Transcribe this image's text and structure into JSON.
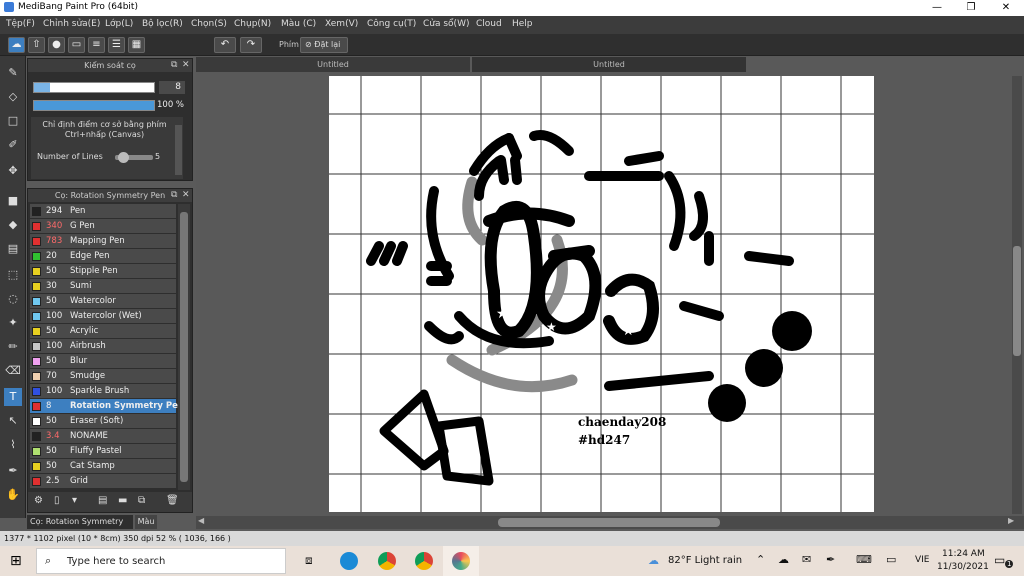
{
  "window": {
    "title": "MediBang Paint Pro (64bit)",
    "min": "—",
    "max": "❐",
    "close": "✕"
  },
  "menu": [
    "Tệp(F)",
    "Chỉnh sửa(E)",
    "Lớp(L)",
    "Bộ lọc(R)",
    "Chọn(S)",
    "Chụp(N)",
    "Màu (C)",
    "Xem(V)",
    "Công cụ(T)",
    "Cửa sổ(W)",
    "Cloud",
    "Help"
  ],
  "toolbar": {
    "keys_label": "Phím",
    "reset_label": "Đặt lại",
    "undo_icon": "undo-icon",
    "redo_icon": "redo-icon"
  },
  "brush_control": {
    "title": "Kiểm soát cọ",
    "size_value": "8",
    "opacity_value": "100 %",
    "hint": "Chỉ định điểm cơ sở bằng phím Ctrl+nhấp (Canvas)",
    "lines_label": "Number of Lines",
    "lines_value": "5",
    "size_fraction": 0.13,
    "opacity_fraction": 1.0,
    "lines_fraction": 0.1
  },
  "brush_panel": {
    "title": "Cọ: Rotation Symmetry Pen",
    "brushes": [
      {
        "size": "294",
        "name": "Pen",
        "color": "#222222"
      },
      {
        "size": "340",
        "name": "G Pen",
        "color": "#e03030",
        "red": true
      },
      {
        "size": "783",
        "name": "Mapping Pen",
        "color": "#e03030",
        "red": true
      },
      {
        "size": "20",
        "name": "Edge Pen",
        "color": "#30c030"
      },
      {
        "size": "50",
        "name": "Stipple Pen",
        "color": "#e8d020"
      },
      {
        "size": "30",
        "name": "Sumi",
        "color": "#e8d020"
      },
      {
        "size": "50",
        "name": "Watercolor",
        "color": "#70c8f0"
      },
      {
        "size": "100",
        "name": "Watercolor (Wet)",
        "color": "#70c8f0"
      },
      {
        "size": "50",
        "name": "Acrylic",
        "color": "#e8d020"
      },
      {
        "size": "100",
        "name": "Airbrush",
        "color": "#c8c8c8"
      },
      {
        "size": "50",
        "name": "Blur",
        "color": "#f0a0f0"
      },
      {
        "size": "70",
        "name": "Smudge",
        "color": "#f0d0b0"
      },
      {
        "size": "100",
        "name": "Sparkle Brush",
        "color": "#3050e0"
      },
      {
        "size": "8",
        "name": "Rotation Symmetry Pen",
        "color": "#e03030",
        "selected": true
      },
      {
        "size": "50",
        "name": "Eraser (Soft)",
        "color": "#ffffff"
      },
      {
        "size": "3.4",
        "name": "NONAME",
        "color": "#222222",
        "red": true
      },
      {
        "size": "50",
        "name": "Fluffy Pastel",
        "color": "#b0e070"
      },
      {
        "size": "50",
        "name": "Cat Stamp",
        "color": "#e8d020"
      },
      {
        "size": "2.5",
        "name": "Grid",
        "color": "#e03030"
      }
    ],
    "footer_tab_active": "Cọ: Rotation Symmetry Pen",
    "footer_tab_other": "Màu"
  },
  "tabs": [
    "Untitled",
    "Untitled"
  ],
  "canvas_text": {
    "line1": "chaenday208",
    "line2": "#hd247"
  },
  "status": "1377 * 1102 pixel  (10 * 8cm)  350 dpi  52 %  ( 1036, 166 )",
  "taskbar": {
    "search_placeholder": "Type here to search",
    "weather": "82°F  Light rain",
    "lang": "VIE",
    "time": "11:24 AM",
    "date": "11/30/2021",
    "notif_count": "1"
  },
  "colors": {
    "accent": "#3d7fc0",
    "panel_bg": "#2e2e2e"
  }
}
